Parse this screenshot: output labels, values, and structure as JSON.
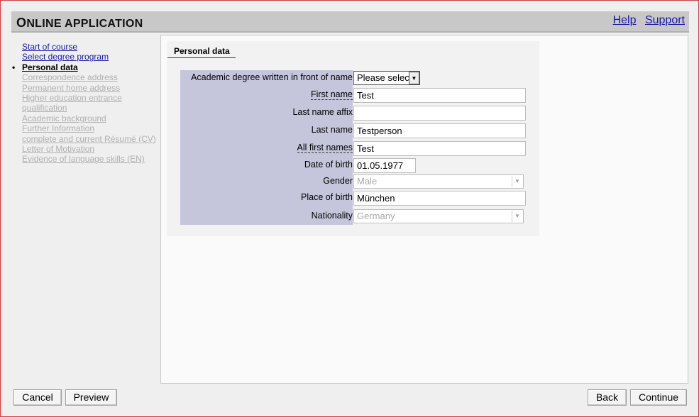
{
  "header": {
    "title_first": "O",
    "title_rest": "NLINE APPLICATION",
    "help_link": "Help",
    "support_link": "Support"
  },
  "sidebar": {
    "items": [
      {
        "label": "Start of course",
        "state": "link"
      },
      {
        "label": "Select degree program",
        "state": "link"
      },
      {
        "label": "Personal data",
        "state": "current"
      },
      {
        "label": "Correspondence address",
        "state": "disabled"
      },
      {
        "label": "Permanent home address",
        "state": "disabled"
      },
      {
        "label": "Higher education entrance qualification",
        "state": "disabled"
      },
      {
        "label": "Academic background",
        "state": "disabled"
      },
      {
        "label": "Further Information",
        "state": "disabled"
      },
      {
        "label": "complete and current Résumé (CV)",
        "state": "disabled"
      },
      {
        "label": "Letter of Motivation",
        "state": "disabled"
      },
      {
        "label": "Evidence of language skills (EN)",
        "state": "disabled"
      }
    ],
    "bullet": "•"
  },
  "section": {
    "tab_label": "Personal data"
  },
  "form": {
    "academic_degree": {
      "label": "Academic degree written in front of name",
      "value": "Please select"
    },
    "first_name": {
      "label": "First name",
      "value": "Test"
    },
    "last_name_affix": {
      "label": "Last name affix",
      "value": ""
    },
    "last_name": {
      "label": "Last name",
      "value": "Testperson"
    },
    "all_first_names": {
      "label": "All first names",
      "value": "Test"
    },
    "date_of_birth": {
      "label": "Date of birth",
      "value": "01.05.1977"
    },
    "gender": {
      "label": "Gender",
      "value": "Male"
    },
    "place_of_birth": {
      "label": "Place of birth",
      "value": "München"
    },
    "nationality": {
      "label": "Nationality",
      "value": "Germany"
    }
  },
  "buttons": {
    "cancel": "Cancel",
    "preview": "Preview",
    "back": "Back",
    "continue": "Continue"
  },
  "icons": {
    "dropdown": "chevron-down-icon"
  },
  "colors": {
    "header_bg": "#c8c8c8",
    "label_bg": "#c5c5dc",
    "link": "#1a1aa6",
    "disabled_link": "#b0b0b0",
    "frame_border": "#d04040"
  }
}
